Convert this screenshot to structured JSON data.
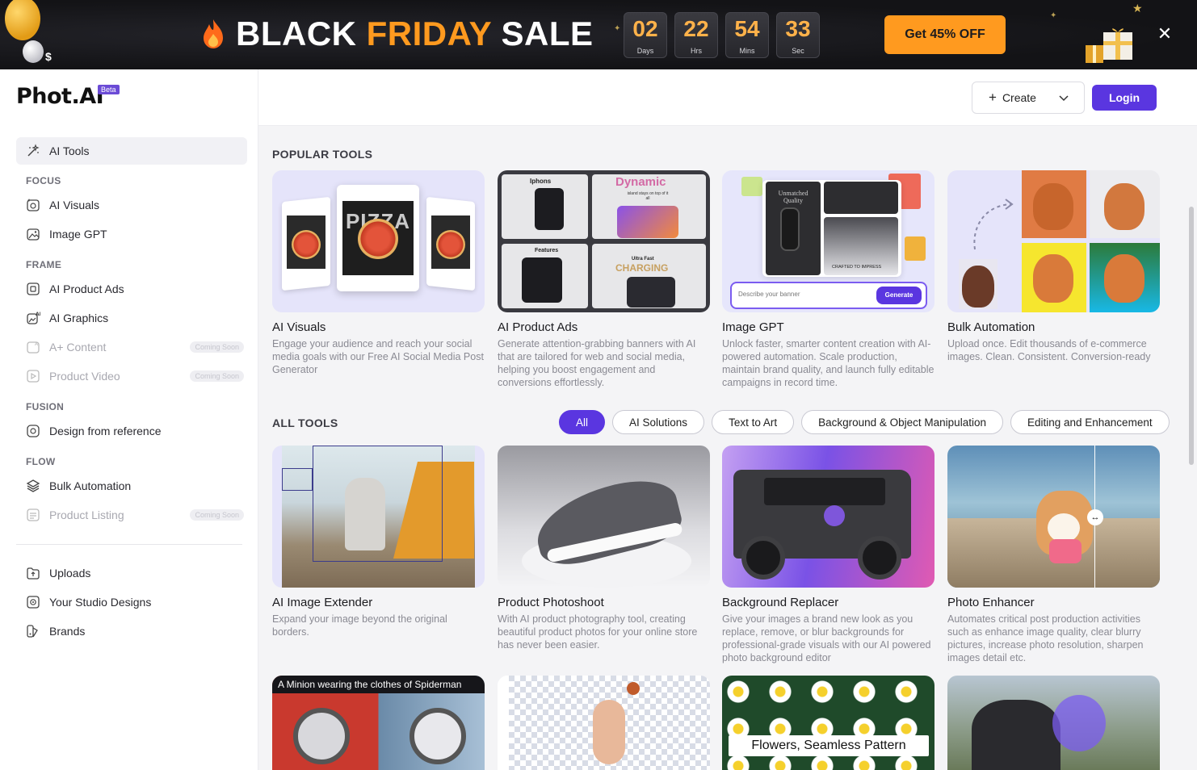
{
  "banner": {
    "title_part1": "BLACK ",
    "title_part2": "FRIDAY",
    "title_part3": " SALE",
    "dollar": "$",
    "countdown": [
      {
        "value": "02",
        "label": "Days"
      },
      {
        "value": "22",
        "label": "Hrs"
      },
      {
        "value": "54",
        "label": "Mins"
      },
      {
        "value": "33",
        "label": "Sec"
      }
    ],
    "cta_label": "Get 45% OFF",
    "close_glyph": "✕",
    "accent_color": "#ff9a1f"
  },
  "sidebar": {
    "logo": "Phot.AI",
    "beta_label": "Beta",
    "ai_tools_label": "AI Tools",
    "sections": {
      "focus": "FOCUS",
      "frame": "FRAME",
      "fusion": "FUSION",
      "flow": "FLOW"
    },
    "items": {
      "ai_visuals": "AI Visuals",
      "image_gpt": "Image GPT",
      "ai_product_ads": "AI Product Ads",
      "ai_graphics": "AI Graphics",
      "a_plus_content": "A+ Content",
      "product_video": "Product Video",
      "design_from_reference": "Design from reference",
      "bulk_automation": "Bulk Automation",
      "product_listing": "Product Listing",
      "uploads": "Uploads",
      "studio_designs": "Your Studio Designs",
      "brands": "Brands"
    },
    "coming_soon": "Coming Soon"
  },
  "header": {
    "create_label": "Create",
    "login_label": "Login",
    "brand_color": "#5a36e0"
  },
  "popular": {
    "title": "POPULAR TOOLS",
    "cards": [
      {
        "title": "AI Visuals",
        "desc": "Engage your audience and reach your social media goals with our Free AI Social Media Post Generator"
      },
      {
        "title": "AI Product Ads",
        "desc": "Generate attention-grabbing banners with AI that are tailored for web and social media, helping you boost engagement and conversions effortlessly."
      },
      {
        "title": "Image GPT",
        "desc": "Unlock faster, smarter content creation with AI-powered automation. Scale production, maintain brand quality, and launch fully editable campaigns in record time."
      },
      {
        "title": "Bulk Automation",
        "desc": "Upload once. Edit thousands of e-commerce images. Clean. Consistent. Conversion-ready"
      }
    ],
    "thumb_text": {
      "pizza": "PIZZA",
      "iphones": "Iphons",
      "dynamic": "Dynamic",
      "island": "island stays on top of it all",
      "features": "Features",
      "ultra_fast": "Ultra Fast",
      "charging": "CHARGING",
      "describe_placeholder": "Describe your banner",
      "generate": "Generate",
      "unmatched": "Unmatched Quality",
      "crafted": "CRAFTED TO IMPRESS"
    }
  },
  "all_tools": {
    "title": "ALL TOOLS",
    "filters": [
      "All",
      "AI Solutions",
      "Text to Art",
      "Background & Object Manipulation",
      "Editing and Enhancement"
    ],
    "cards": [
      {
        "title": "AI Image Extender",
        "desc": "Expand your image beyond the original borders."
      },
      {
        "title": "Product Photoshoot",
        "desc": "With AI product photography tool, creating beautiful product photos for your online store has never been easier."
      },
      {
        "title": "Background Replacer",
        "desc": "Give your images a brand new look as you replace, remove, or blur backgrounds for professional-grade visuals with our AI powered photo background editor"
      },
      {
        "title": "Photo Enhancer",
        "desc": "Automates critical post production activities such as enhance image quality, clear blurry pictures, increase photo resolution, sharpen images detail etc."
      }
    ],
    "row3_captions": {
      "minion": "A Minion wearing the clothes of Spiderman",
      "flowers": "Flowers, Seamless Pattern"
    }
  }
}
